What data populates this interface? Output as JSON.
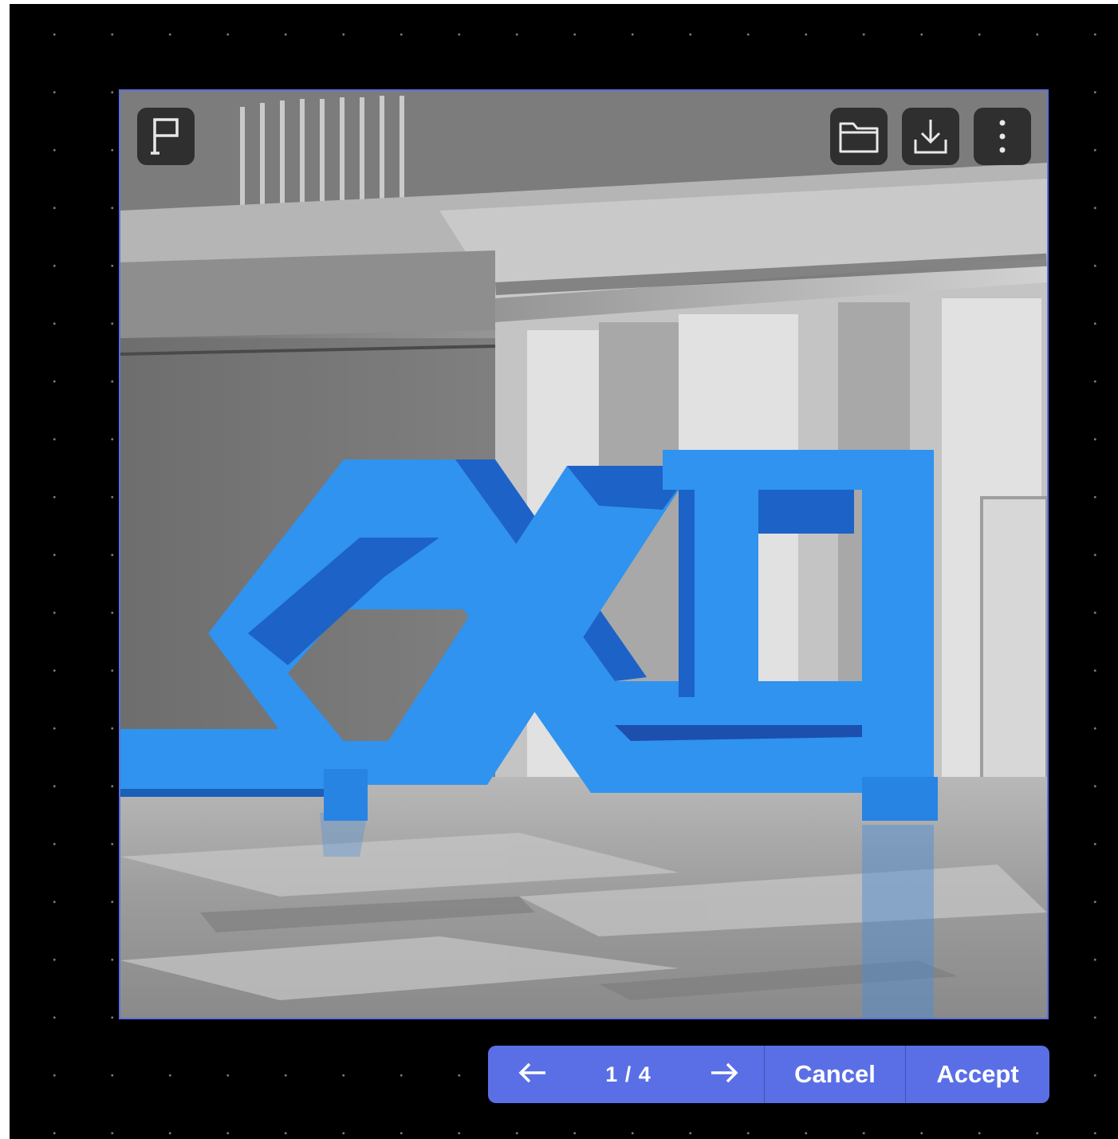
{
  "viewer": {
    "page_indicator": "1 / 4",
    "cancel_label": "Cancel",
    "accept_label": "Accept",
    "icons": {
      "flag": "flag-icon",
      "folder": "folder-icon",
      "download": "download-icon",
      "more": "more-vertical-icon",
      "prev": "arrow-left-icon",
      "next": "arrow-right-icon"
    }
  },
  "colors": {
    "accent": "#5a6fe6",
    "frame_border": "#5b6fe0",
    "background": "#000000",
    "sculpture_blue": "#2f93ef"
  }
}
